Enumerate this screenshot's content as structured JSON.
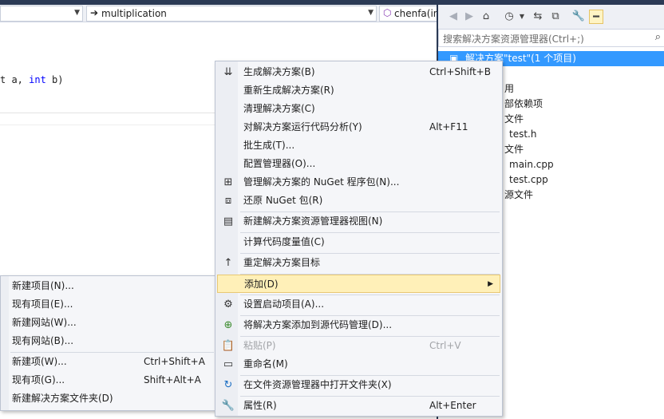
{
  "editor": {
    "nav_left_value": "",
    "nav_middle_value": "multiplication",
    "nav_right_value": "chenfa(in",
    "code_fragment_prefix": "t a, ",
    "code_kw": "int",
    "code_fragment_suffix": " b)"
  },
  "solution_explorer": {
    "search_placeholder": "搜索解决方案资源管理器(Ctrl+;)",
    "tree": [
      {
        "label": "解决方案\"test\"(1 个项目)",
        "selected": true
      },
      {
        "label": "用"
      },
      {
        "label": "部依赖项"
      },
      {
        "label": "文件"
      },
      {
        "label": "test.h"
      },
      {
        "label": "文件"
      },
      {
        "label": "main.cpp"
      },
      {
        "label": "test.cpp"
      },
      {
        "label": "源文件"
      }
    ]
  },
  "main_menu": {
    "items": [
      {
        "label": "生成解决方案(B)",
        "shortcut": "Ctrl+Shift+B",
        "icon": "build-solution-icon"
      },
      {
        "label": "重新生成解决方案(R)",
        "shortcut": ""
      },
      {
        "label": "清理解决方案(C)",
        "shortcut": ""
      },
      {
        "label": "对解决方案运行代码分析(Y)",
        "shortcut": "Alt+F11"
      },
      {
        "label": "批生成(T)...",
        "shortcut": ""
      },
      {
        "label": "配置管理器(O)...",
        "shortcut": ""
      },
      {
        "label": "管理解决方案的 NuGet 程序包(N)...",
        "shortcut": "",
        "icon": "nuget-package-icon"
      },
      {
        "label": "还原 NuGet 包(R)",
        "shortcut": "",
        "icon": "restore-package-icon"
      },
      {
        "label": "新建解决方案资源管理器视图(N)",
        "shortcut": "",
        "icon": "new-view-icon"
      },
      {
        "label": "计算代码度量值(C)",
        "shortcut": ""
      },
      {
        "label": "重定解决方案目标",
        "shortcut": "",
        "icon": "retarget-arrow-icon"
      },
      {
        "label": "添加(D)",
        "shortcut": "",
        "highlighted": true
      },
      {
        "label": "设置启动项目(A)...",
        "shortcut": "",
        "icon": "gear-icon"
      },
      {
        "label": "将解决方案添加到源代码管理(D)...",
        "shortcut": "",
        "icon": "source-control-add-icon"
      },
      {
        "label": "粘贴(P)",
        "shortcut": "Ctrl+V",
        "disabled": true,
        "icon": "paste-icon"
      },
      {
        "label": "重命名(M)",
        "shortcut": "",
        "icon": "rename-icon"
      },
      {
        "label": "在文件资源管理器中打开文件夹(X)",
        "shortcut": "",
        "icon": "open-folder-arrow-icon"
      },
      {
        "label": "属性(R)",
        "shortcut": "Alt+Enter",
        "icon": "wrench-icon"
      }
    ]
  },
  "sub_menu": {
    "items": [
      {
        "label": "新建项目(N)...",
        "shortcut": ""
      },
      {
        "label": "现有项目(E)...",
        "shortcut": ""
      },
      {
        "label": "新建网站(W)...",
        "shortcut": ""
      },
      {
        "label": "现有网站(B)...",
        "shortcut": ""
      },
      {
        "label": "新建项(W)...",
        "shortcut": "Ctrl+Shift+A"
      },
      {
        "label": "现有项(G)...",
        "shortcut": "Shift+Alt+A"
      },
      {
        "label": "新建解决方案文件夹(D)",
        "shortcut": ""
      }
    ]
  }
}
